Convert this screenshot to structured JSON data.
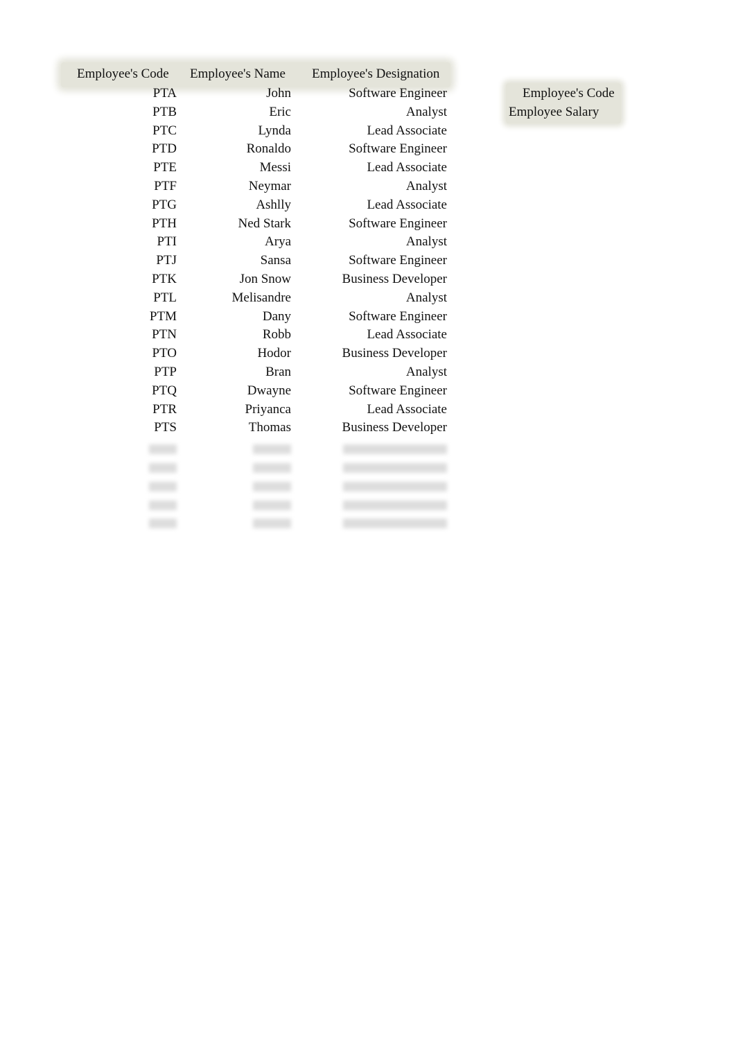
{
  "table": {
    "headers": [
      "Employee's Code",
      "Employee's Name",
      "Employee's Designation"
    ],
    "rows": [
      [
        "PTA",
        "John",
        "Software Engineer"
      ],
      [
        "PTB",
        "Eric",
        "Analyst"
      ],
      [
        "PTC",
        "Lynda",
        "Lead Associate"
      ],
      [
        "PTD",
        "Ronaldo",
        "Software Engineer"
      ],
      [
        "PTE",
        "Messi",
        "Lead Associate"
      ],
      [
        "PTF",
        "Neymar",
        "Analyst"
      ],
      [
        "PTG",
        "Ashlly",
        "Lead Associate"
      ],
      [
        "PTH",
        "Ned Stark",
        "Software Engineer"
      ],
      [
        "PTI",
        "Arya",
        "Analyst"
      ],
      [
        "PTJ",
        "Sansa",
        "Software Engineer"
      ],
      [
        "PTK",
        "Jon Snow",
        "Business Developer"
      ],
      [
        "PTL",
        "Melisandre",
        "Analyst"
      ],
      [
        "PTM",
        "Dany",
        "Software Engineer"
      ],
      [
        "PTN",
        "Robb",
        "Lead Associate"
      ],
      [
        "PTO",
        "Hodor",
        "Business Developer"
      ],
      [
        "PTP",
        "Bran",
        "Analyst"
      ],
      [
        "PTQ",
        "Dwayne",
        "Software Engineer"
      ],
      [
        "PTR",
        "Priyanca",
        "Lead Associate"
      ],
      [
        "PTS",
        "Thomas",
        "Business Developer"
      ]
    ],
    "blurred_rows": 5
  },
  "side_box": {
    "line1": "Employee's Code",
    "line2": "Employee Salary"
  }
}
